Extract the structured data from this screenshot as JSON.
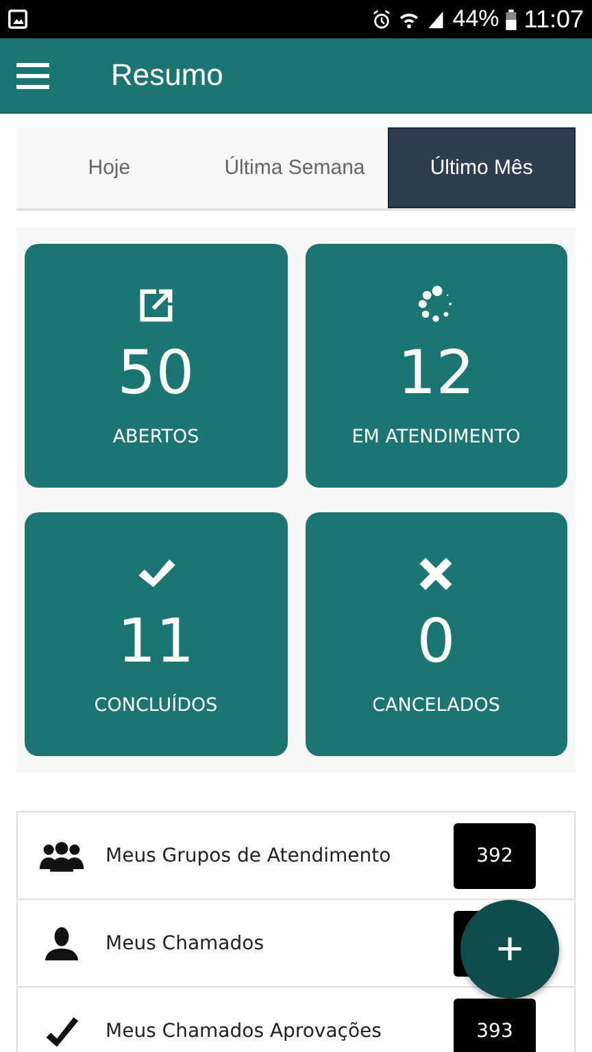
{
  "status_bar": {
    "battery_text": "44%",
    "time": "11:07"
  },
  "app_bar": {
    "title": "Resumo"
  },
  "tabs": [
    {
      "label": "Hoje",
      "selected": false
    },
    {
      "label": "Última Semana",
      "selected": false
    },
    {
      "label": "Último Mês",
      "selected": true
    }
  ],
  "cards": [
    {
      "kind": "open",
      "count": "50",
      "label": "ABERTOS"
    },
    {
      "kind": "spinner",
      "count": "12",
      "label": "EM ATENDIMENTO"
    },
    {
      "kind": "check",
      "count": "11",
      "label": "CONCLUÍDOS"
    },
    {
      "kind": "cross",
      "count": "0",
      "label": "CANCELADOS"
    }
  ],
  "list": [
    {
      "kind": "group",
      "label": "Meus Grupos de Atendimento",
      "count": "392"
    },
    {
      "kind": "person",
      "label": "Meus Chamados"
    },
    {
      "kind": "check",
      "label": "Meus Chamados Aprovações",
      "count": "393"
    }
  ],
  "fab": {
    "label": "+"
  }
}
